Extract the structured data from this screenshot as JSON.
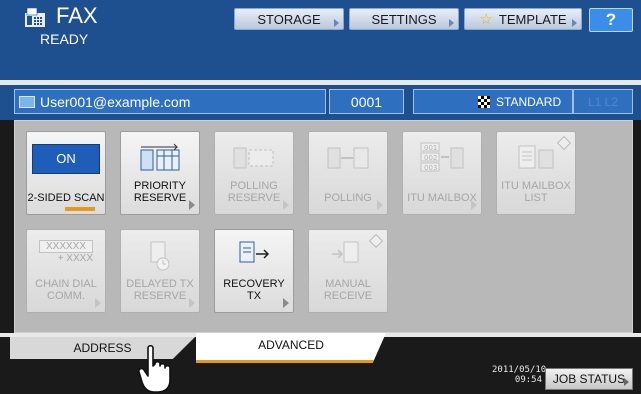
{
  "header": {
    "title": "FAX",
    "status": "READY",
    "storage_label": "STORAGE",
    "settings_label": "SETTINGS",
    "template_label": "TEMPLATE",
    "help_label": "?"
  },
  "address_bar": {
    "recipient": "User001@example.com",
    "count": "0001",
    "resolution": "STANDARD",
    "lines": "L1 L2"
  },
  "functions": [
    {
      "label": "2-SIDED SCAN",
      "state": "ON",
      "enabled": true
    },
    {
      "label": "PRIORITY RESERVE",
      "enabled": true
    },
    {
      "label": "POLLING RESERVE",
      "enabled": false
    },
    {
      "label": "POLLING",
      "enabled": false
    },
    {
      "label": "ITU MAILBOX",
      "enabled": false
    },
    {
      "label": "ITU MAILBOX LIST",
      "enabled": false
    },
    {
      "label": "CHAIN DIAL COMM.",
      "enabled": false,
      "icon_text": "XXXXXX",
      "icon_sub": "+ XXXX"
    },
    {
      "label": "DELAYED TX RESERVE",
      "enabled": false
    },
    {
      "label": "RECOVERY TX",
      "enabled": true
    },
    {
      "label": "MANUAL RECEIVE",
      "enabled": false
    }
  ],
  "tabs": {
    "address": "ADDRESS",
    "advanced": "ADVANCED",
    "active": "advanced"
  },
  "footer": {
    "date": "2011/05/10",
    "time": "09:54",
    "job_status": "JOB STATUS"
  },
  "colors": {
    "header_blue": "#1e4f8f",
    "field_blue": "#2f6fc0",
    "accent_orange": "#e79a1a",
    "help_blue": "#3a8ee8"
  }
}
